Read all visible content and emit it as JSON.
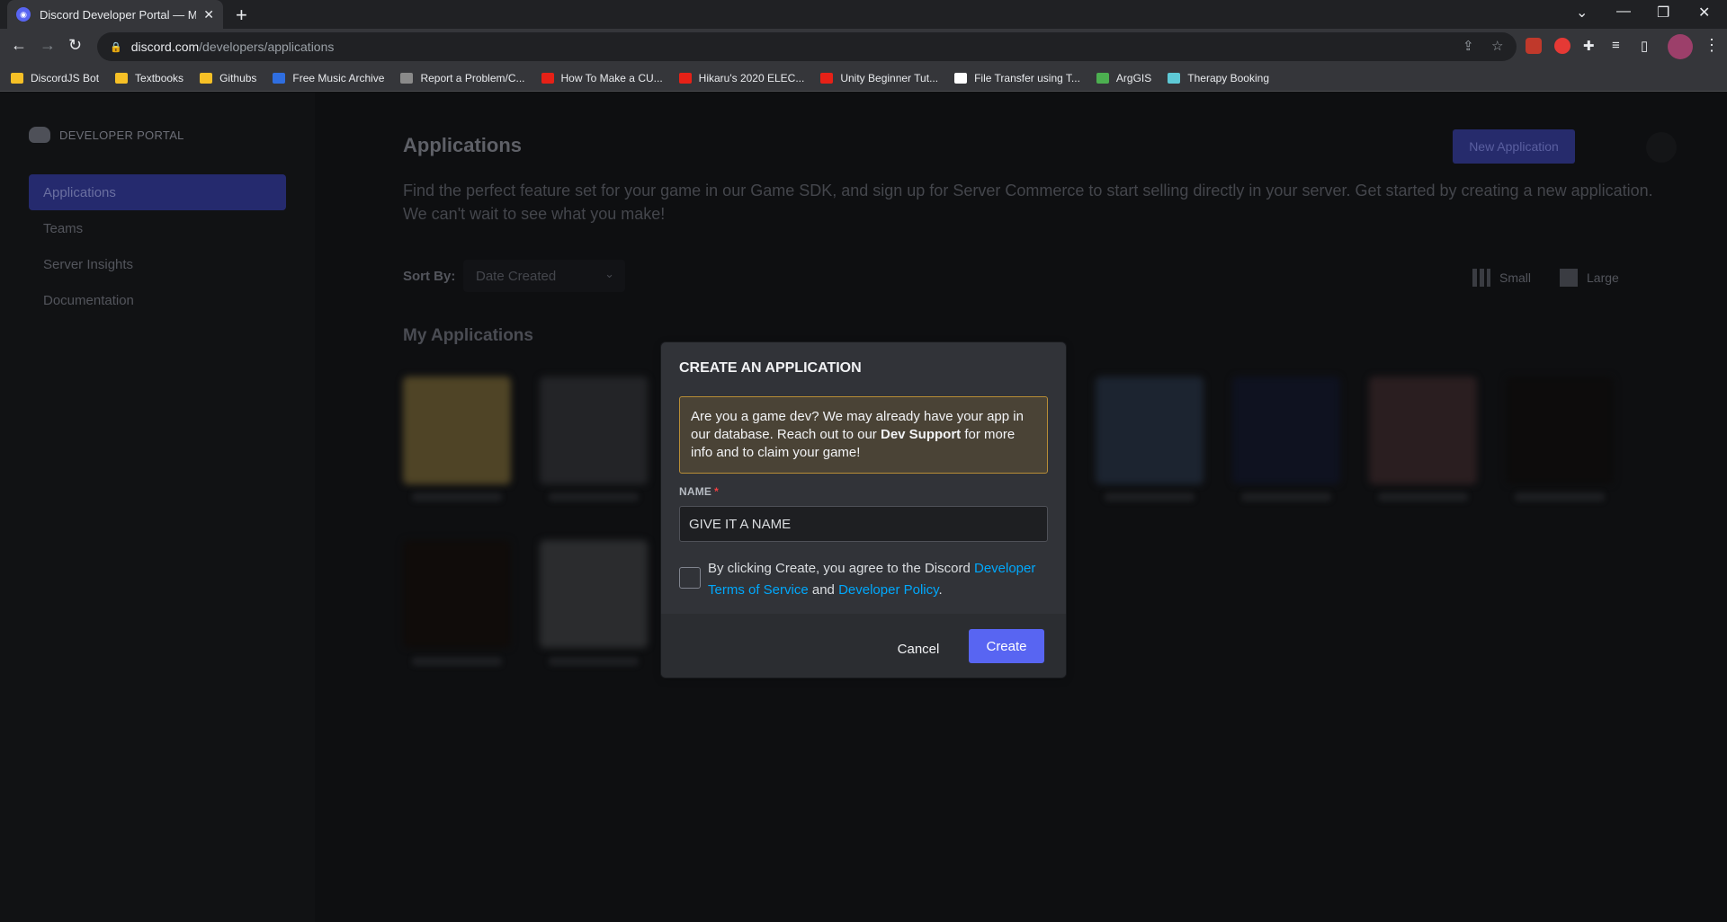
{
  "browser": {
    "tab_title": "Discord Developer Portal — My /",
    "tab_close": "✕",
    "new_tab": "+",
    "url_host": "discord.com",
    "url_path": "/developers/applications",
    "bookmarks": [
      {
        "label": "DiscordJS Bot",
        "color": "#f6c026"
      },
      {
        "label": "Textbooks",
        "color": "#f6c026"
      },
      {
        "label": "Githubs",
        "color": "#f6c026"
      },
      {
        "label": "Free Music Archive",
        "color": "#2f6ee0"
      },
      {
        "label": "Report a Problem/C...",
        "color": "#8a8a8a"
      },
      {
        "label": "How To Make a CU...",
        "color": "#e62117"
      },
      {
        "label": "Hikaru's 2020 ELEC...",
        "color": "#e62117"
      },
      {
        "label": "Unity Beginner Tut...",
        "color": "#e62117"
      },
      {
        "label": "File Transfer using T...",
        "color": "#ffffff"
      },
      {
        "label": "ArgGIS",
        "color": "#4caf50"
      },
      {
        "label": "Therapy Booking",
        "color": "#5ec9d6"
      }
    ]
  },
  "sidebar": {
    "logo_text": "DEVELOPER PORTAL",
    "items": [
      {
        "label": "Applications"
      },
      {
        "label": "Teams"
      },
      {
        "label": "Server Insights"
      },
      {
        "label": "Documentation"
      }
    ]
  },
  "main": {
    "title": "Applications",
    "new_app_label": "New Application",
    "description": "Find the perfect feature set for your game in our Game SDK, and sign up for Server Commerce to start selling directly in your server. Get started by creating a new application. We can't wait to see what you make!",
    "sort_label": "Sort By:",
    "sort_value": "Date Created",
    "view_small": "Small",
    "view_large": "Large",
    "section_title": "My Applications"
  },
  "modal": {
    "title": "CREATE AN APPLICATION",
    "notice_pre": "Are you a game dev? We may already have your app in our database. Reach out to our ",
    "notice_bold": "Dev Support",
    "notice_post": " for more info and to claim your game!",
    "name_label": "NAME",
    "name_required": "*",
    "name_value": "GIVE IT A NAME",
    "terms_pre": "By clicking Create, you agree to the Discord ",
    "terms_link1": "Developer Terms of Service",
    "terms_mid": " and ",
    "terms_link2": "Developer Policy",
    "terms_post": ".",
    "cancel_label": "Cancel",
    "create_label": "Create"
  },
  "colors": {
    "accent": "#5865f2",
    "link": "#00a8fc",
    "warning_border": "#b88d36"
  }
}
